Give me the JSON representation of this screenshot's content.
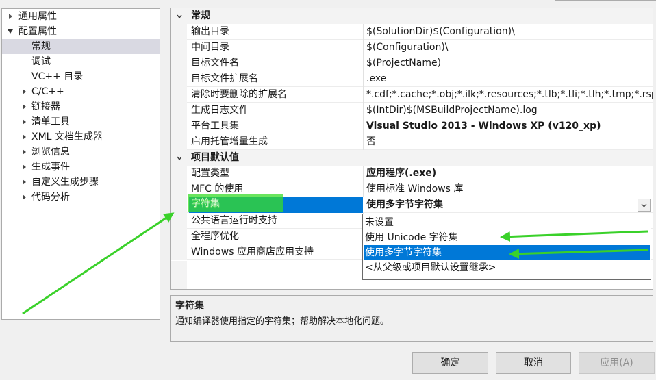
{
  "tree": {
    "items": [
      {
        "label": "通用属性",
        "expander": "right"
      },
      {
        "label": "配置属性",
        "expander": "down"
      },
      {
        "label": "常规",
        "expander": "none",
        "selected": true
      },
      {
        "label": "调试",
        "expander": "none"
      },
      {
        "label": "VC++ 目录",
        "expander": "none"
      },
      {
        "label": "C/C++",
        "expander": "right"
      },
      {
        "label": "链接器",
        "expander": "right"
      },
      {
        "label": "清单工具",
        "expander": "right"
      },
      {
        "label": "XML 文档生成器",
        "expander": "right"
      },
      {
        "label": "浏览信息",
        "expander": "right"
      },
      {
        "label": "生成事件",
        "expander": "right"
      },
      {
        "label": "自定义生成步骤",
        "expander": "right"
      },
      {
        "label": "代码分析",
        "expander": "right"
      }
    ]
  },
  "grid": {
    "sections": [
      {
        "title": "常规",
        "properties": [
          {
            "name": "输出目录",
            "value": "$(SolutionDir)$(Configuration)\\"
          },
          {
            "name": "中间目录",
            "value": "$(Configuration)\\"
          },
          {
            "name": "目标文件名",
            "value": "$(ProjectName)"
          },
          {
            "name": "目标文件扩展名",
            "value": ".exe"
          },
          {
            "name": "清除时要删除的扩展名",
            "value": "*.cdf;*.cache;*.obj;*.ilk;*.resources;*.tlb;*.tli;*.tlh;*.tmp;*.rsp;*.pgc;*.pgd"
          },
          {
            "name": "生成日志文件",
            "value": "$(IntDir)$(MSBuildProjectName).log"
          },
          {
            "name": "平台工具集",
            "value": "Visual Studio 2013 - Windows XP (v120_xp)"
          },
          {
            "name": "启用托管增量生成",
            "value": "否"
          }
        ]
      },
      {
        "title": "项目默认值",
        "properties": [
          {
            "name": "配置类型",
            "value": "应用程序(.exe)"
          },
          {
            "name": "MFC 的使用",
            "value": "使用标准 Windows 库"
          },
          {
            "name": "字符集",
            "value": "使用多字节字符集"
          },
          {
            "name": "公共语言运行时支持",
            "value": ""
          },
          {
            "name": "全程序优化",
            "value": ""
          },
          {
            "name": "Windows 应用商店应用支持",
            "value": ""
          }
        ]
      }
    ]
  },
  "dropdown": {
    "options": [
      "未设置",
      "使用 Unicode 字符集",
      "使用多字节字符集",
      "<从父级或项目默认设置继承>"
    ],
    "selected_index": 2
  },
  "description": {
    "title": "字符集",
    "text": "通知编译器使用指定的字符集；帮助解决本地化问题。"
  },
  "buttons": {
    "ok": "确定",
    "cancel": "取消",
    "apply": "应用(A)"
  },
  "annotation": {
    "highlight_label": "字符集",
    "color": "#3ad12a"
  }
}
